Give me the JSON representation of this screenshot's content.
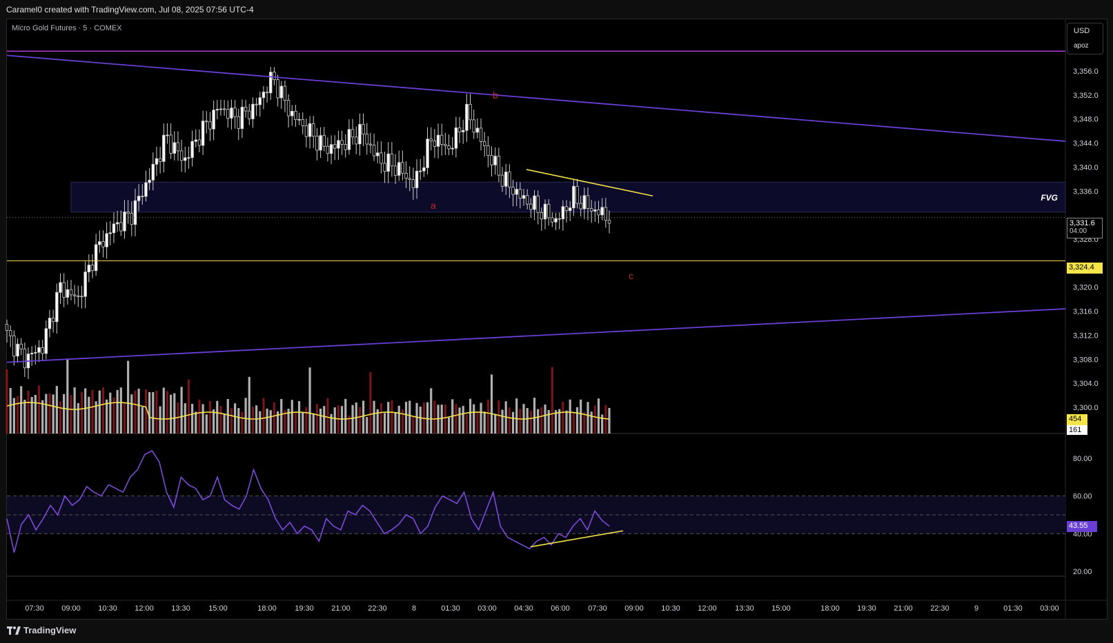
{
  "header": {
    "caption": "Caramel0 created with TradingView.com, Jul 08, 2025 07:56 UTC-4"
  },
  "legend": {
    "symbol": "Micro Gold Futures · 5 · COMEX"
  },
  "currency": {
    "code": "USD",
    "profile": "apoz"
  },
  "brand": {
    "name": "TradingView"
  },
  "colors": {
    "accent_purple": "#6a3fd6",
    "pivot_line": "#b03ad6",
    "level_yellow": "#f5e44a",
    "fvg_fill": "#0d0b2a",
    "rsi_line": "#7c4bd8",
    "volume_ma": "#f5e44a"
  },
  "annotations": {
    "fvg": "FVG",
    "a": "a",
    "b": "b",
    "c": "c"
  },
  "badges": {
    "price": "3,331.6",
    "countdown": "04:00",
    "level": "3,324.4",
    "vol_ma": "454",
    "vol": "161",
    "rsi": "43.55"
  },
  "chart_data": [
    {
      "type": "candlestick",
      "title": "Micro Gold Futures · 5 · COMEX",
      "y_ticks": [
        "3,356.0",
        "3,352.0",
        "3,348.0",
        "3,344.0",
        "3,340.0",
        "3,336.0",
        "3,328.0",
        "3,320.0",
        "3,316.0",
        "3,312.0",
        "3,308.0",
        "3,304.0",
        "3,300.0"
      ],
      "x_ticks": [
        "07:30",
        "09:00",
        "10:30",
        "12:00",
        "13:30",
        "15:00",
        "18:00",
        "19:30",
        "21:00",
        "22:30",
        "8",
        "01:30",
        "03:00",
        "04:30",
        "06:00",
        "07:30",
        "09:00",
        "10:30",
        "12:00",
        "13:30",
        "15:00",
        "18:00",
        "19:30",
        "21:00",
        "22:30",
        "9",
        "01:30",
        "03:00"
      ],
      "ylim": [
        3300,
        3360
      ],
      "close_path_approx": [
        {
          "t": "07:00",
          "v": 3312
        },
        {
          "t": "07:30",
          "v": 3308
        },
        {
          "t": "08:30",
          "v": 3310
        },
        {
          "t": "09:00",
          "v": 3320
        },
        {
          "t": "10:00",
          "v": 3318
        },
        {
          "t": "10:30",
          "v": 3326
        },
        {
          "t": "11:00",
          "v": 3330
        },
        {
          "t": "12:00",
          "v": 3332
        },
        {
          "t": "12:30",
          "v": 3338
        },
        {
          "t": "13:00",
          "v": 3345
        },
        {
          "t": "14:00",
          "v": 3341
        },
        {
          "t": "15:00",
          "v": 3346
        },
        {
          "t": "16:00",
          "v": 3350
        },
        {
          "t": "17:00",
          "v": 3348
        },
        {
          "t": "18:00",
          "v": 3350
        },
        {
          "t": "18:10",
          "v": 3355
        },
        {
          "t": "19:00",
          "v": 3349
        },
        {
          "t": "19:30",
          "v": 3346
        },
        {
          "t": "20:30",
          "v": 3343
        },
        {
          "t": "21:30",
          "v": 3344
        },
        {
          "t": "22:30",
          "v": 3346
        },
        {
          "t": "23:30",
          "v": 3341
        },
        {
          "t": "00:30",
          "v": 3340
        },
        {
          "t": "01:00",
          "v": 3337
        },
        {
          "t": "01:30",
          "v": 3345
        },
        {
          "t": "02:30",
          "v": 3343
        },
        {
          "t": "03:00",
          "v": 3349
        },
        {
          "t": "03:30",
          "v": 3343
        },
        {
          "t": "04:00",
          "v": 3338
        },
        {
          "t": "04:30",
          "v": 3335
        },
        {
          "t": "05:00",
          "v": 3333
        },
        {
          "t": "06:00",
          "v": 3331
        },
        {
          "t": "07:00",
          "v": 3335
        },
        {
          "t": "07:30",
          "v": 3333
        },
        {
          "t": "07:56",
          "v": 3331.6
        }
      ],
      "levels": [
        {
          "name": "horizontal-level",
          "value": 3324.4
        },
        {
          "name": "top-magenta-line",
          "value": 3359.3
        }
      ],
      "fvg_zone": [
        3332.5,
        3337.5
      ],
      "trendlines": [
        {
          "name": "upper-channel",
          "from": {
            "t": "start",
            "v": 3358.6
          },
          "to": {
            "t": "end",
            "v": 3344.3
          }
        },
        {
          "name": "lower-channel",
          "from": {
            "t": "start",
            "v": 3307.5
          },
          "to": {
            "t": "end",
            "v": 3316.4
          }
        },
        {
          "name": "yellow-resistance",
          "from": {
            "t": "04:30",
            "v": 3339.6
          },
          "to": {
            "t": "09:00",
            "v": 3335.2
          }
        }
      ]
    },
    {
      "type": "bar",
      "title": "Volume",
      "latest": 161,
      "ma_latest": 454
    },
    {
      "type": "line",
      "title": "RSI",
      "y_ticks": [
        "80.00",
        "60.00",
        "40.00",
        "20.00"
      ],
      "ylim": [
        15,
        90
      ],
      "bands": [
        40,
        50,
        60
      ],
      "latest": 43.55,
      "values_approx": [
        48,
        30,
        45,
        50,
        42,
        48,
        55,
        50,
        60,
        55,
        58,
        65,
        62,
        60,
        66,
        64,
        62,
        70,
        74,
        82,
        84,
        78,
        62,
        54,
        70,
        66,
        64,
        58,
        60,
        70,
        58,
        55,
        53,
        60,
        74,
        64,
        58,
        48,
        42,
        46,
        40,
        44,
        42,
        36,
        48,
        44,
        42,
        52,
        50,
        55,
        52,
        46,
        40,
        42,
        45,
        50,
        48,
        40,
        44,
        54,
        60,
        58,
        56,
        62,
        48,
        42,
        52,
        62,
        44,
        38,
        36,
        34,
        32,
        36,
        38,
        34,
        40,
        38,
        44,
        48,
        42,
        52,
        47,
        44
      ]
    }
  ]
}
